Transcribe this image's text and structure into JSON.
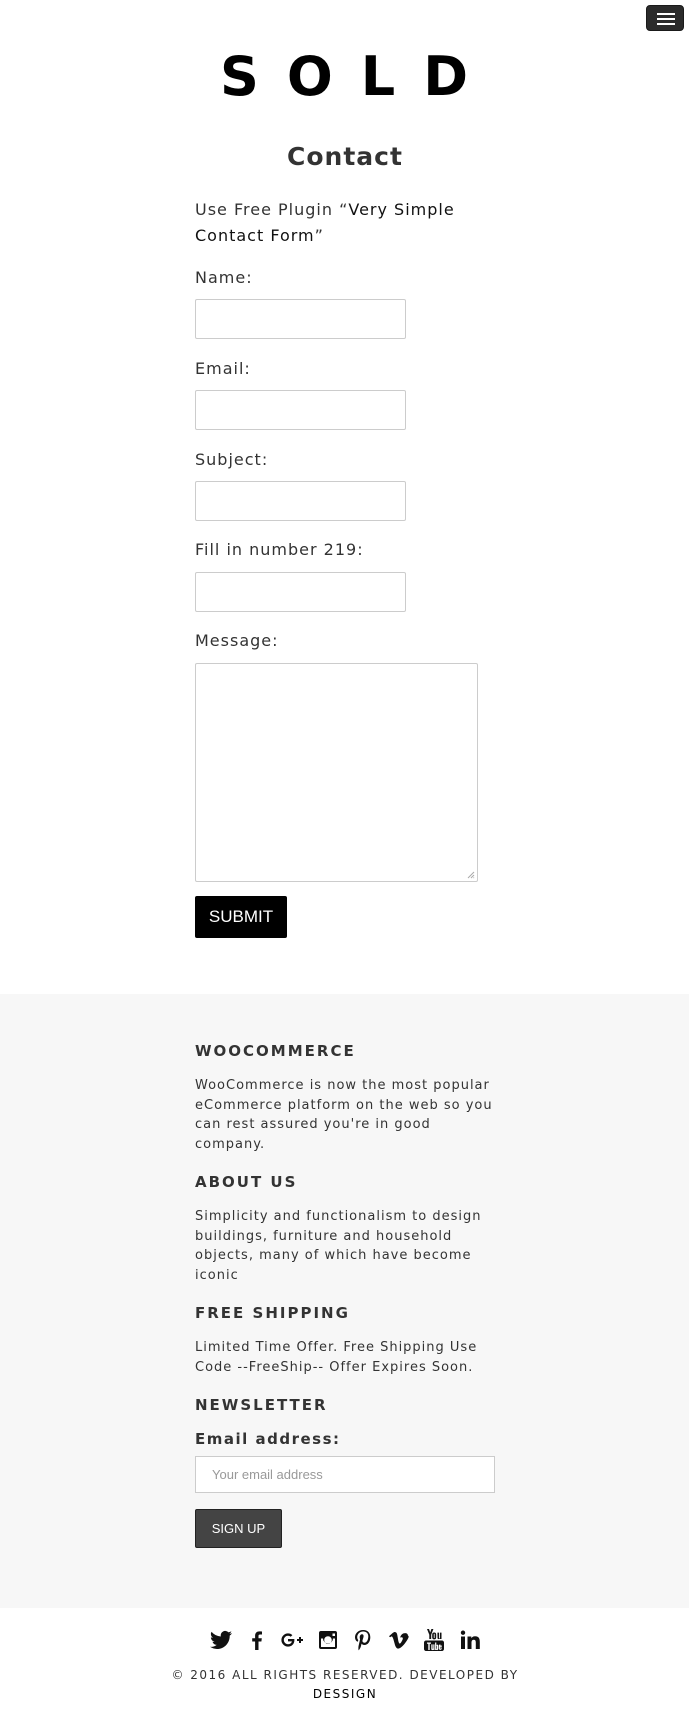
{
  "header": {
    "menu_icon": "hamburger-menu-icon",
    "logo_text": "SOLD"
  },
  "page": {
    "title": "Contact",
    "intro_prefix": "Use Free Plugin “",
    "intro_plugin": "Very Simple Contact Form",
    "intro_suffix": "”"
  },
  "form": {
    "name_label": "Name:",
    "name_value": "",
    "email_label": "Email:",
    "email_value": "",
    "subject_label": "Subject:",
    "subject_value": "",
    "captcha_label": "Fill in number 219:",
    "captcha_value": "",
    "message_label": "Message:",
    "message_value": "",
    "submit_label": "SUBMIT"
  },
  "footer": {
    "background": "#f7f7f7",
    "sections": [
      {
        "heading": "WOOCOMMERCE",
        "text": "WooCommerce is now the most popular eCommerce platform on the web so you can rest assured you're in good company."
      },
      {
        "heading": "ABOUT US",
        "text": "Simplicity and functionalism to design buildings, furniture and household objects, many of which have become iconic"
      },
      {
        "heading": "FREE SHIPPING",
        "text": "Limited Time Offer. Free Shipping Use Code --FreeShip-- Offer Expires Soon."
      },
      {
        "heading": "NEWSLETTER"
      }
    ],
    "newsletter": {
      "email_label": "Email address:",
      "email_placeholder": "Your email address",
      "signup_label": "SIGN UP"
    }
  },
  "bottom": {
    "social_icons": [
      "twitter-icon",
      "facebook-icon",
      "google-plus-icon",
      "instagram-icon",
      "pinterest-icon",
      "vimeo-icon",
      "youtube-icon",
      "linkedin-icon"
    ],
    "copyright_prefix": "© 2016 ALL RIGHTS RESERVED. DEVELOPED BY ",
    "copyright_brand": "DESSIGN"
  }
}
